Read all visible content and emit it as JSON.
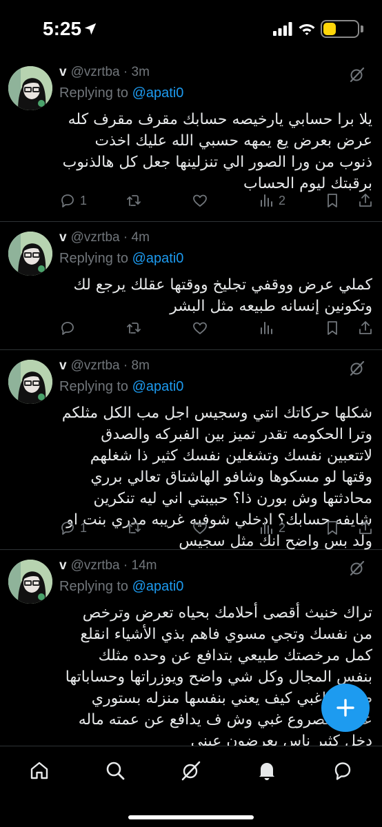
{
  "status_bar": {
    "time": "5:25",
    "battery_level": "7",
    "icons": [
      "location-arrow-icon",
      "cellular-signal-icon",
      "wifi-icon",
      "battery-icon"
    ],
    "battery_color": "#ffd60a"
  },
  "colors": {
    "background": "#000000",
    "text": "#e7e9ea",
    "muted": "#71767b",
    "accent": "#1d9bf0",
    "divider": "#2f3336"
  },
  "tweets": [
    {
      "author": "v",
      "handle": "@vzrtba",
      "time": "3m",
      "replying_label": "Replying to",
      "replying_to": "@apati0",
      "text": "يلا برا حسابي يارخيصه حسابك مقرف مقرف كله عرض بعرض يع يمهه حسبي الله عليك اخذت ذنوب من ورا الصور الي تنزلينها جعل كل هالذنوب برقبتك ليوم الحساب",
      "replies": "1",
      "retweets": "",
      "likes": "",
      "views": "2",
      "show_grok": true
    },
    {
      "author": "v",
      "handle": "@vzrtba",
      "time": "4m",
      "replying_label": "Replying to",
      "replying_to": "@apati0",
      "text": "كملي عرض ووقفي تجليخ ووقتها عقلك يرجع لك وتكونين إنسانه طبيعه مثل البشر",
      "replies": "",
      "retweets": "",
      "likes": "",
      "views": "",
      "show_grok": false
    },
    {
      "author": "v",
      "handle": "@vzrtba",
      "time": "8m",
      "replying_label": "Replying to",
      "replying_to": "@apati0",
      "text": "شكلها حركاتك انتي وسجيس اجل مب الكل مثلكم وترا الحكومه تقدر تميز بين الفبركه والصدق لاتتعبين نفسك وتشغلين نفسك كثير ذا شغلهم وقتها لو مسكوها وشافو الهاشتاق تعالي برري محادثتها وش بورن ذا؟ حبيبتي اني ليه تنكرين شايفه حسابك؟ ادخلي شوفيه غريبه مدري بنت او ولد بس واضح انك مثل سجيس",
      "replies": "1",
      "retweets": "",
      "likes": "",
      "views": "2",
      "show_grok": true
    },
    {
      "author": "v",
      "handle": "@vzrtba",
      "time": "14m",
      "replying_label": "Replying to",
      "replying_to": "@apati0",
      "text": "تراك خنيث أقصى أحلامك بحياه تعرض وترخص من نفسك وتجي مسوي فاهم بذي الأشياء انقلع كمل مرخصتك طبيعي بتدافع عن وحده مثلك بنفس المجال وكل شي واضح ويوزراتها وحساباتها طالعه ياغبي كيف يعني بنفسها منزله بستوري عندها مصروع غبي وش ف يدافع عن عمته ماله دخل كثير ناس يعرضون عيني",
      "replies": "",
      "retweets": "",
      "likes": "",
      "views": "",
      "show_grok": true
    }
  ],
  "fab": {
    "icon": "plus-icon"
  },
  "bottom_nav": [
    {
      "name": "home",
      "icon": "home-icon"
    },
    {
      "name": "search",
      "icon": "search-icon"
    },
    {
      "name": "grok",
      "icon": "grok-icon"
    },
    {
      "name": "notifications",
      "icon": "bell-icon"
    },
    {
      "name": "messages",
      "icon": "chat-bubble-icon"
    }
  ]
}
